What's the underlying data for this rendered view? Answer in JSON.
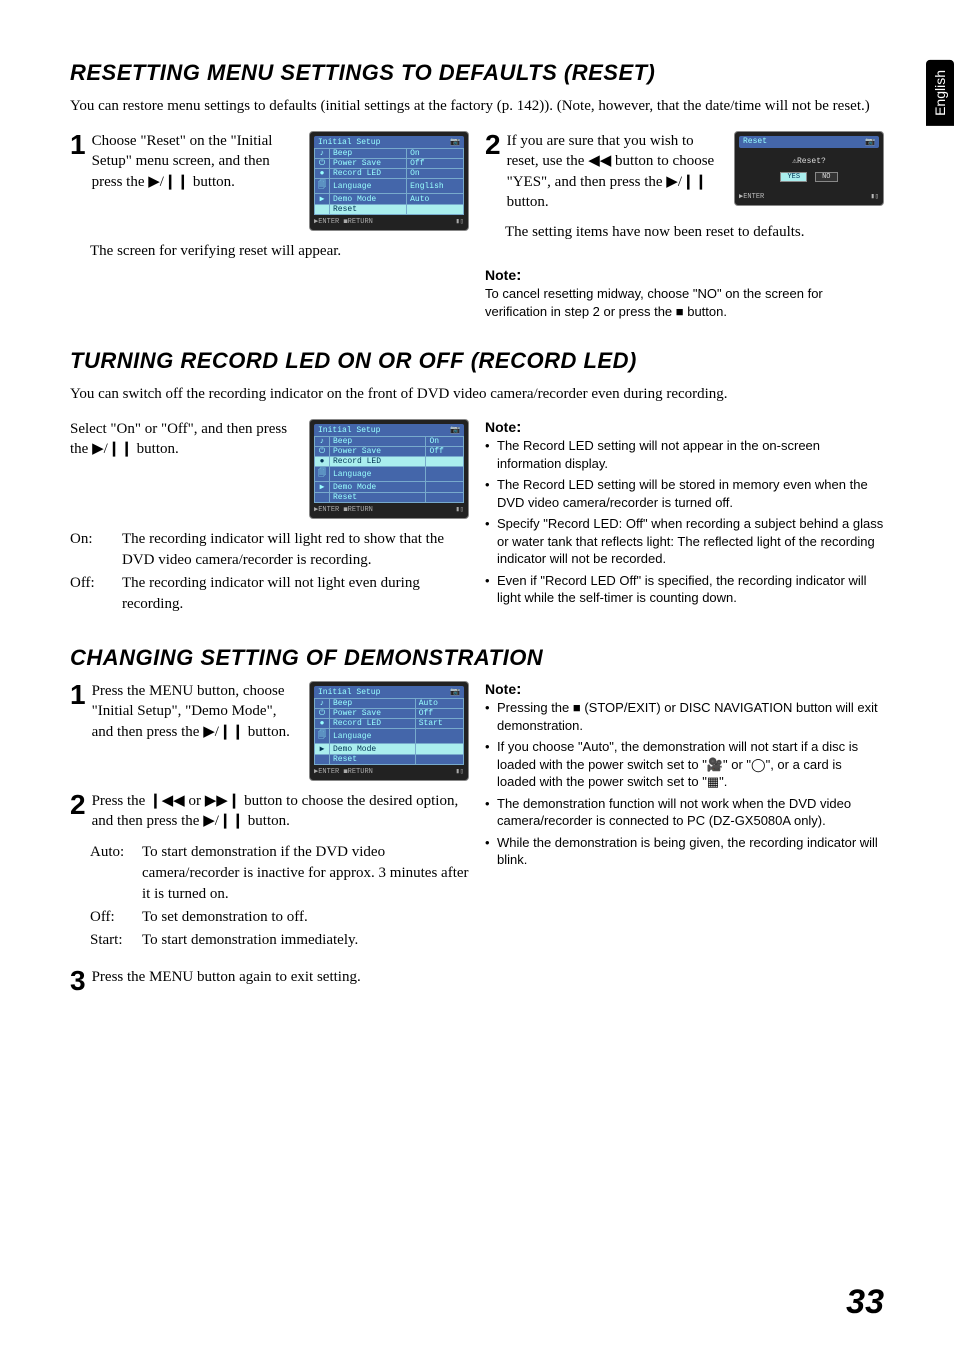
{
  "language_tab": "English",
  "page_number": "33",
  "section1": {
    "title": "RESETTING MENU SETTINGS TO DEFAULTS (RESET)",
    "intro": "You can restore menu settings to defaults (initial settings at the factory (p. 142)). (Note, however, that the date/time will not be reset.)",
    "step1_num": "1",
    "step1": "Choose \"Reset\" on the \"Initial Setup\" menu screen, and then press the ▶/❙❙ button.",
    "sub1": "The screen for verifying reset will appear.",
    "step2_num": "2",
    "step2": "If you are sure that you wish to reset, use the ◀◀ button to choose \"YES\", and then press the ▶/❙❙ button.",
    "sub2": "The setting items have now been reset to defaults.",
    "note_head": "Note",
    "note_body": "To cancel resetting midway, choose \"NO\" on the screen for verification in step 2 or press the ■ button.",
    "osd1": {
      "title": "Initial Setup",
      "rows": [
        {
          "label": "Beep",
          "val": "On"
        },
        {
          "label": "Power Save",
          "val": "Off"
        },
        {
          "label": "Record LED",
          "val": "On"
        },
        {
          "label": "Language",
          "val": "English"
        },
        {
          "label": "Demo Mode",
          "val": "Auto"
        },
        {
          "label": "Reset",
          "val": ""
        }
      ],
      "enter": "ENTER",
      "return": "RETURN"
    },
    "osd2": {
      "title": "Reset",
      "prompt": "⚠Reset?",
      "yes": "YES",
      "no": "NO",
      "enter": "ENTER"
    }
  },
  "section2": {
    "title": "TURNING RECORD LED ON OR OFF (RECORD LED)",
    "intro": "You can switch off the recording indicator on the front of DVD video camera/recorder even during recording.",
    "body1": "Select \"On\" or \"Off\", and then press the ▶/❙❙ button.",
    "on_label": "On:",
    "on_text": "The recording indicator will light red to show that the DVD video camera/recorder is recording.",
    "off_label": "Off:",
    "off_text": "The recording indicator will not light even during recording.",
    "note_head": "Note",
    "notes": [
      "The Record LED setting will not appear in the on-screen information display.",
      "The Record LED setting will be stored in memory even when the DVD video camera/recorder is turned off.",
      "Specify \"Record LED: Off\" when recording a subject behind a glass or water tank that reflects light: The reflected light of the recording indicator will not be recorded.",
      "Even if \"Record LED Off\" is specified, the recording indicator will light while the self-timer is counting down."
    ],
    "osd": {
      "title": "Initial Setup",
      "rows": [
        {
          "label": "Beep",
          "val": "On"
        },
        {
          "label": "Power Save",
          "val": "Off"
        },
        {
          "label": "Record LED",
          "val": ""
        },
        {
          "label": "Language",
          "val": ""
        },
        {
          "label": "Demo Mode",
          "val": ""
        },
        {
          "label": "Reset",
          "val": ""
        }
      ],
      "enter": "ENTER",
      "return": "RETURN"
    }
  },
  "section3": {
    "title": "CHANGING SETTING OF DEMONSTRATION",
    "step1_num": "1",
    "step1": "Press the MENU button, choose \"Initial Setup\", \"Demo Mode\", and then press the ▶/❙❙ button.",
    "step2_num": "2",
    "step2": "Press the ❙◀◀ or ▶▶❙ button to choose the desired option, and then press the ▶/❙❙ button.",
    "defs": [
      {
        "label": "Auto:",
        "text": "To start demonstration if the DVD video camera/recorder is inactive for approx. 3 minutes after it is turned on."
      },
      {
        "label": "Off:",
        "text": "To set demonstration to off."
      },
      {
        "label": "Start:",
        "text": "To start demonstration immediately."
      }
    ],
    "step3_num": "3",
    "step3": "Press the MENU button again to exit setting.",
    "note_head": "Note",
    "notes": [
      "Pressing the ■ (STOP/EXIT) or DISC NAVIGATION button will exit demonstration.",
      "If you choose \"Auto\", the demonstration will not start if a disc is loaded with the power switch set to \"🎥\" or \"◯\", or a card is loaded with the power switch set to \"▦\".",
      "The demonstration function will not work when the DVD video camera/recorder is connected to PC (DZ-GX5080A only).",
      "While the demonstration is being given, the recording indicator will blink."
    ],
    "osd": {
      "title": "Initial Setup",
      "rows": [
        {
          "label": "Beep",
          "val": "Auto"
        },
        {
          "label": "Power Save",
          "val": "Off"
        },
        {
          "label": "Record LED",
          "val": "Start"
        },
        {
          "label": "Language",
          "val": ""
        },
        {
          "label": "Demo Mode",
          "val": ""
        },
        {
          "label": "Reset",
          "val": ""
        }
      ],
      "enter": "ENTER",
      "return": "RETURN"
    }
  }
}
